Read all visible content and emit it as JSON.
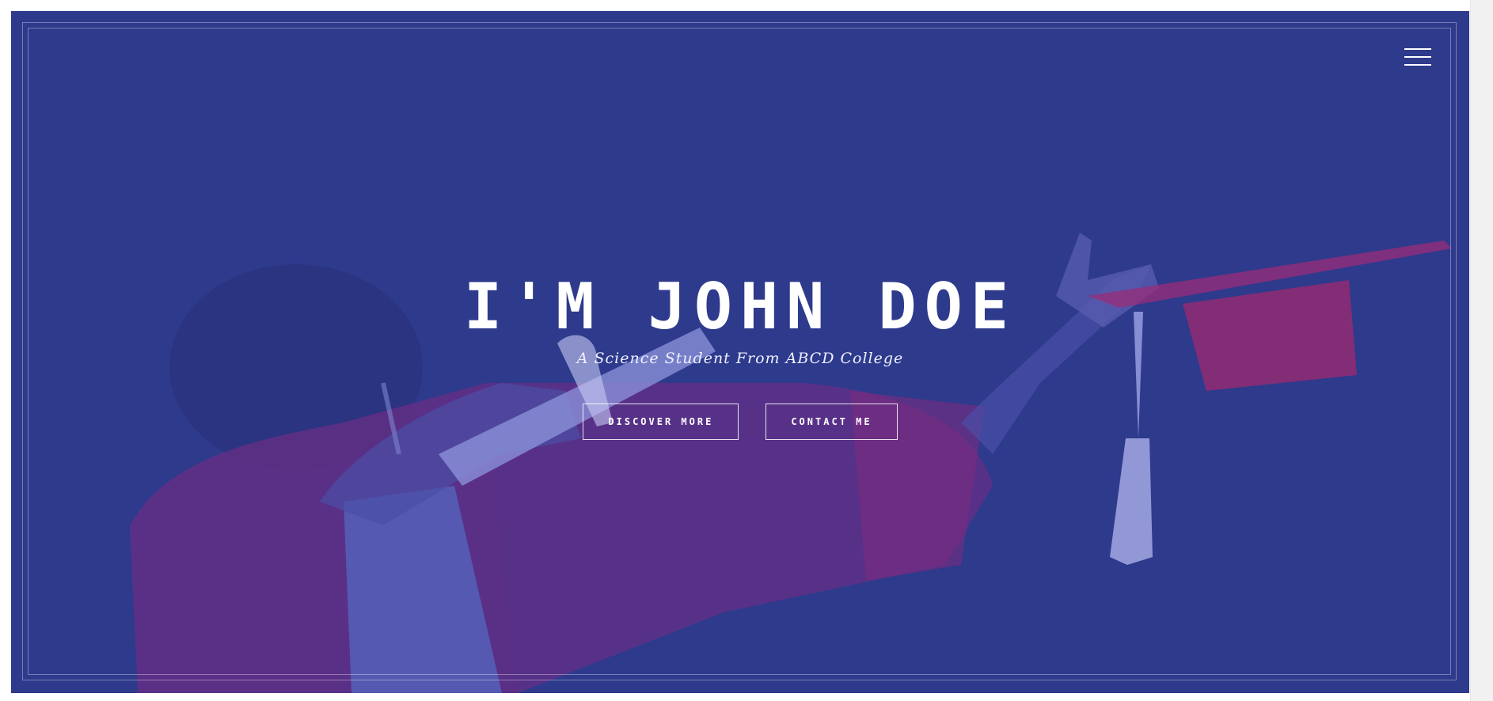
{
  "hero": {
    "title": "I'M JOHN DOE",
    "subtitle": "A Science Student From ABCD College",
    "background_color": "#2e3a8c",
    "background_image": "graduate-in-red-gown-dabbing-with-diploma-and-cap"
  },
  "nav": {
    "menu_icon": "hamburger-menu-icon"
  },
  "buttons": {
    "discover_label": "DISCOVER MORE",
    "contact_label": "CONTACT ME"
  },
  "colors": {
    "overlay": "#2e3a8c",
    "gown": "#8a2a78",
    "text": "#ffffff"
  }
}
